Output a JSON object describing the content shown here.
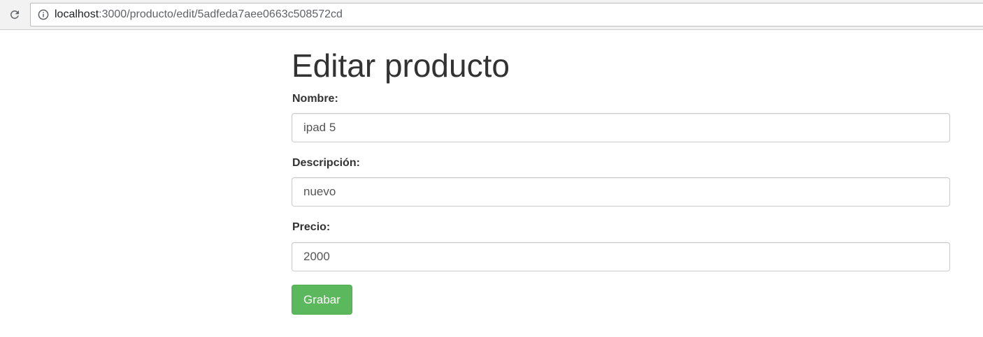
{
  "browser": {
    "url_host": "localhost",
    "url_path": ":3000/producto/edit/5adfeda7aee0663c508572cd",
    "icons": {
      "reload": "reload-icon",
      "info": "info-icon"
    }
  },
  "page": {
    "title": "Editar producto"
  },
  "form": {
    "nombre": {
      "label": "Nombre:",
      "value": "ipad 5"
    },
    "descripcion": {
      "label": "Descripción:",
      "value": "nuevo"
    },
    "precio": {
      "label": "Precio:",
      "value": "2000"
    },
    "submit_label": "Grabar"
  },
  "colors": {
    "button_bg": "#5cb85c",
    "text": "#333333"
  }
}
